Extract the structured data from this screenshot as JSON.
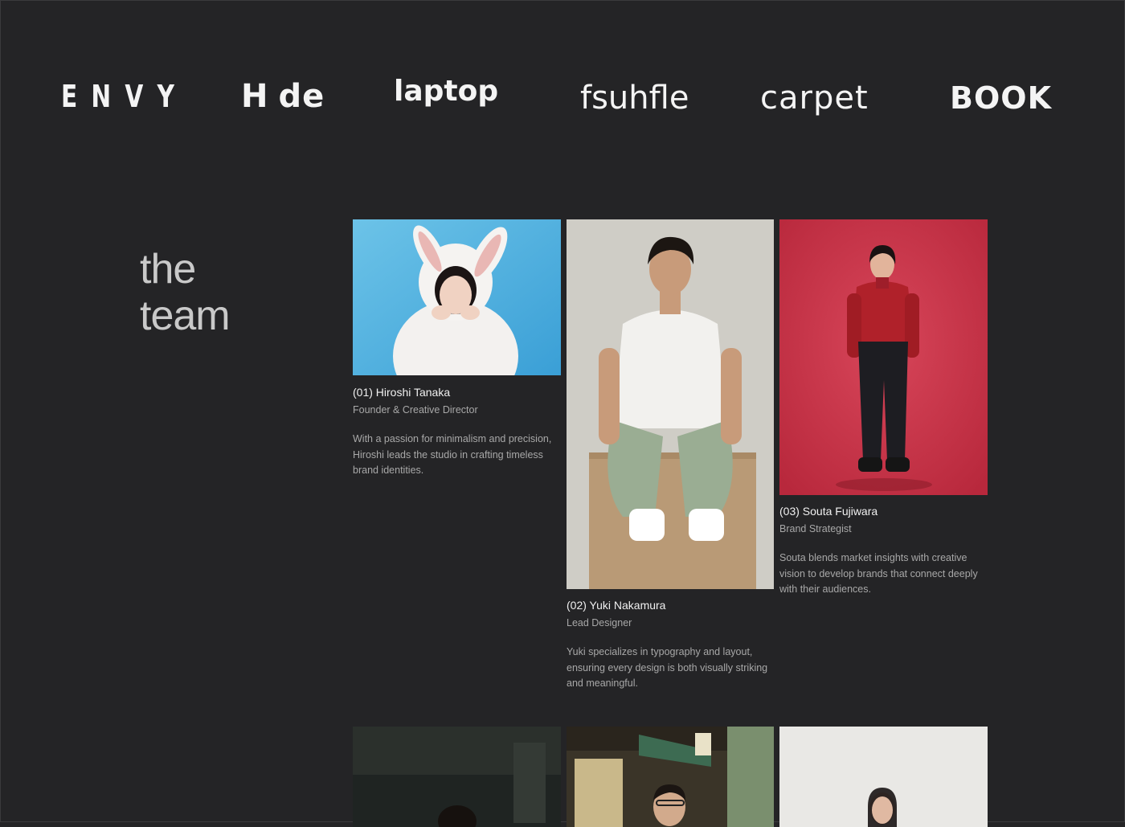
{
  "logos": [
    {
      "name": "ENVY"
    },
    {
      "part1": "H",
      "part2": "de"
    },
    {
      "name": "laptop"
    },
    {
      "name": "fsuhfle"
    },
    {
      "name": "carpet"
    },
    {
      "name": "BOOK"
    }
  ],
  "heading": {
    "line1": "the",
    "line2": "team"
  },
  "team": [
    {
      "name": "(01) Hiroshi Tanaka",
      "role": "Founder & Creative Director",
      "bio": "With a passion for minimalism and precision, Hiroshi leads the studio in crafting timeless brand identities."
    },
    {
      "name": "(02) Yuki Nakamura",
      "role": "Lead Designer",
      "bio": "Yuki specializes in typography and layout, ensuring every design is both visually striking and meaningful."
    },
    {
      "name": "(03) Souta Fujiwara",
      "role": "Brand Strategist",
      "bio": "Souta blends market insights with creative vision to develop brands that connect deeply with their audiences."
    }
  ],
  "colors": {
    "background": "#242426",
    "text": "#e8e8e8",
    "muted": "#a8a8a8",
    "heading": "#c9c9c9"
  }
}
